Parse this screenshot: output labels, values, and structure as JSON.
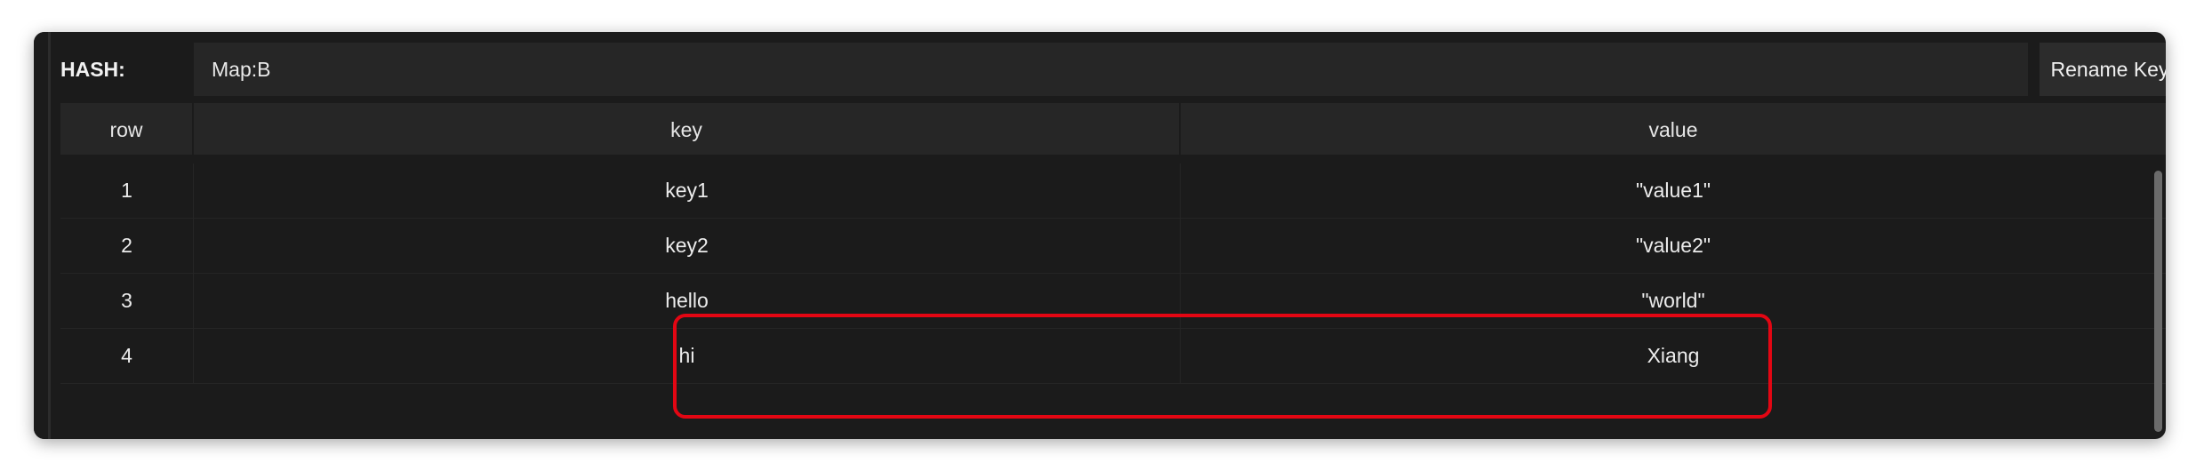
{
  "hash_bar": {
    "label": "HASH:",
    "key_value": "Map:B",
    "rename_label": "Rename Key"
  },
  "table": {
    "columns": [
      "row",
      "key",
      "value"
    ],
    "rows": [
      {
        "row": "1",
        "key": "key1",
        "value": "\"value1\""
      },
      {
        "row": "2",
        "key": "key2",
        "value": "\"value2\""
      },
      {
        "row": "3",
        "key": "hello",
        "value": "\"world\""
      },
      {
        "row": "4",
        "key": "hi",
        "value": "Xiang"
      }
    ]
  },
  "annotation": {
    "highlight_color": "#e30613"
  },
  "colors": {
    "background": "#1b1b1b",
    "header": "#262626",
    "text": "#ececec"
  }
}
